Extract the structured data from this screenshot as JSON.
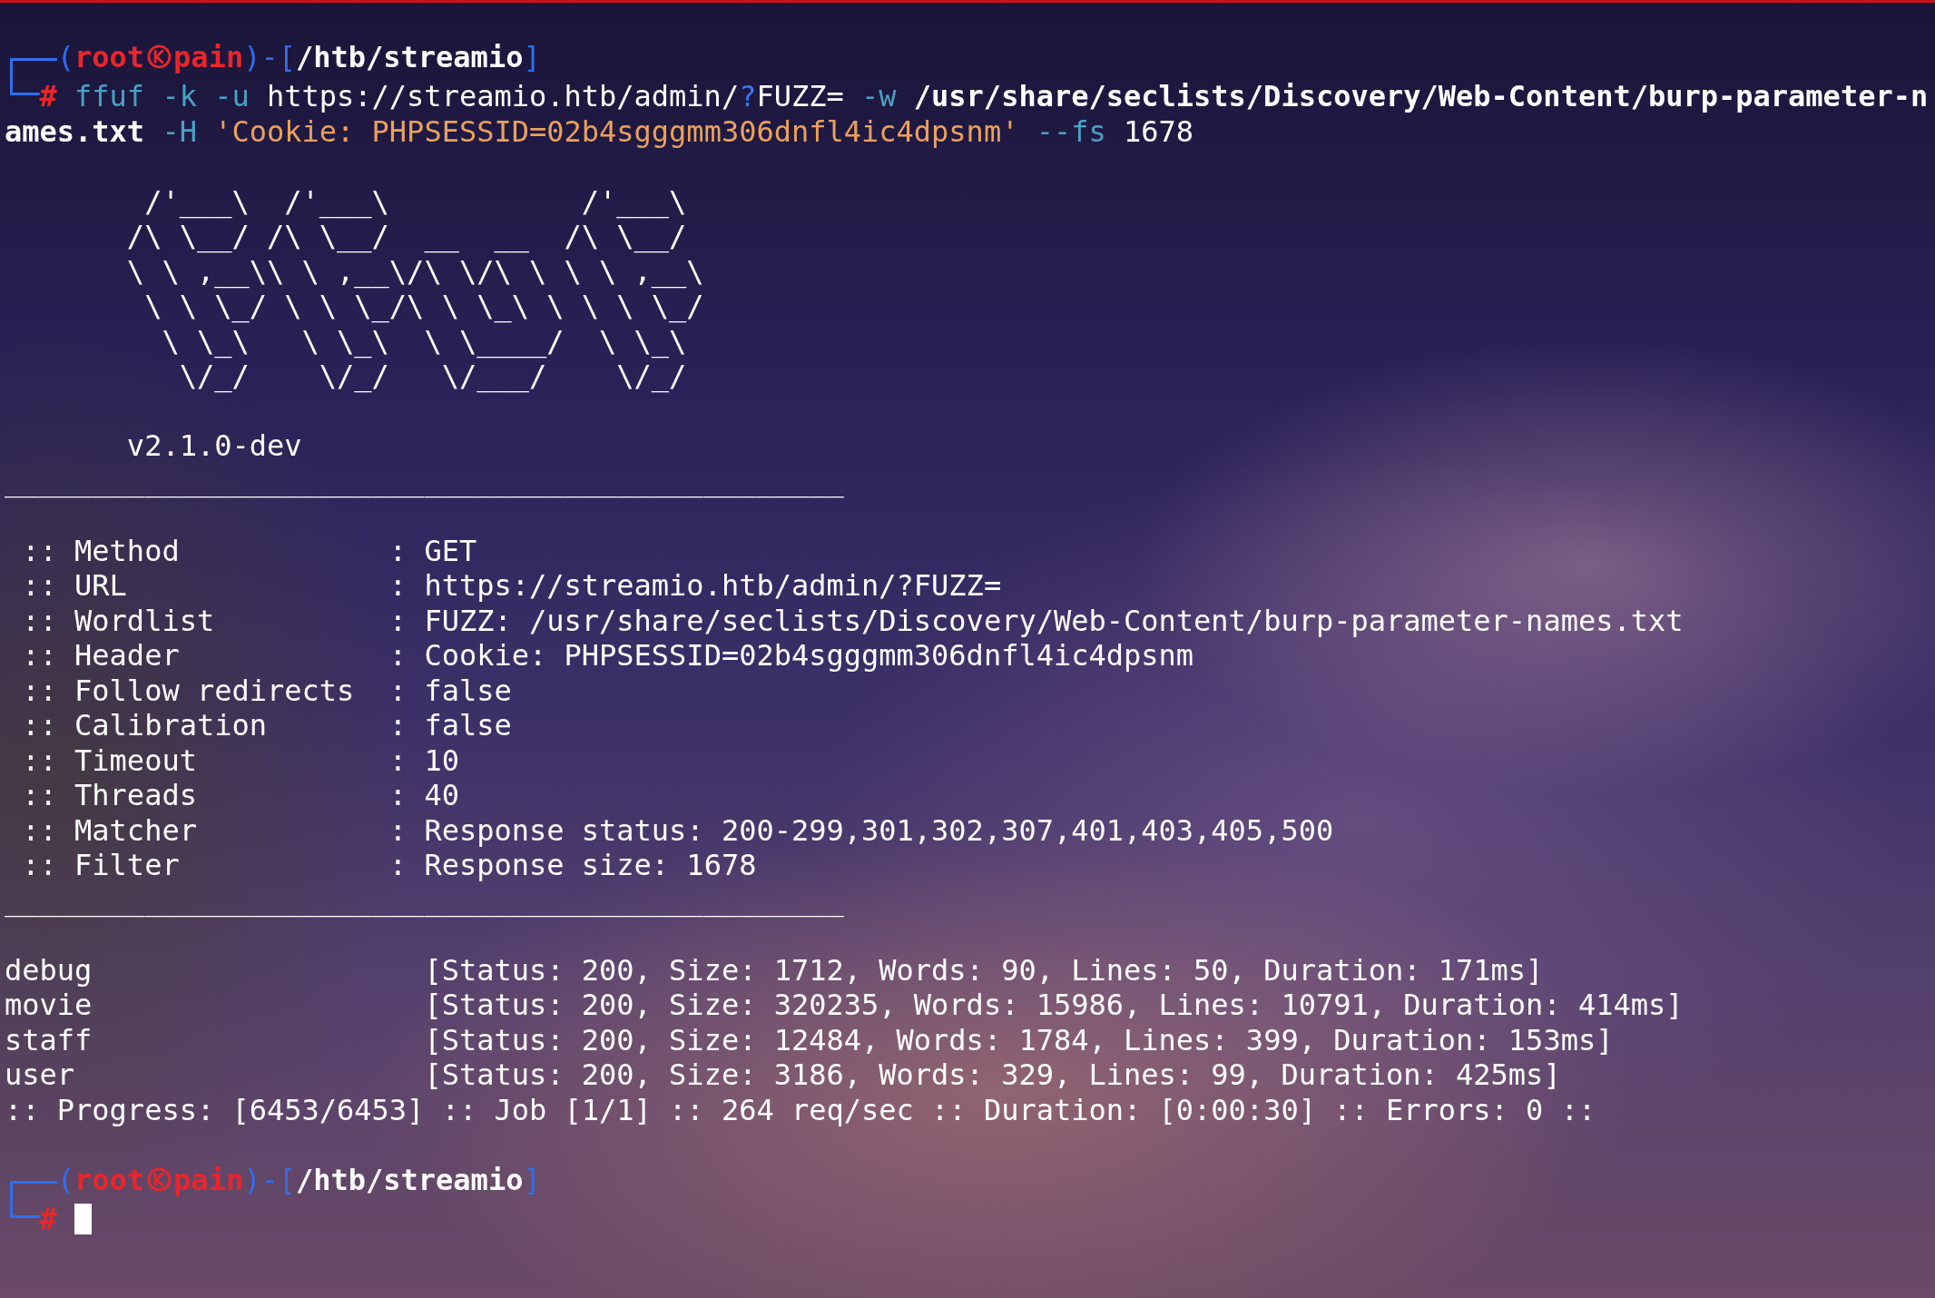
{
  "prompt": {
    "bracket_open": "(",
    "user": "root",
    "host": "pain",
    "separator": ")-[",
    "path": "/htb/streamio",
    "bracket_close": "]",
    "hash": "#",
    "command_rows": [
      [
        {
          "kind": "program",
          "text": "ffuf"
        },
        {
          "kind": "option",
          "text": "-k -u"
        },
        {
          "kind": "argument",
          "text": "https://streamio.htb/admin/"
        },
        {
          "kind": "special",
          "text": "?",
          "joined": true
        },
        {
          "kind": "argument",
          "text": "FUZZ=",
          "joined": true
        },
        {
          "kind": "option",
          "text": "-w"
        },
        {
          "kind": "path",
          "text": "/usr/share/seclists/Discovery/Web-Content/burp-parameter-n"
        }
      ],
      [
        {
          "kind": "path",
          "text": "ames.txt"
        },
        {
          "kind": "option",
          "text": "-H"
        },
        {
          "kind": "string",
          "text": "'Cookie: PHPSESSID=02b4sgggmm306dnfl4ic4dpsnm'"
        },
        {
          "kind": "option",
          "text": "--fs"
        },
        {
          "kind": "argument",
          "text": "1678"
        }
      ]
    ]
  },
  "banner": {
    "lines": [
      " /'___\\  /'___\\           /'___\\",
      "/\\ \\__/ /\\ \\__/  __  __  /\\ \\__/",
      "\\ \\ ,__\\\\ \\ ,__\\/\\ \\/\\ \\ \\ \\ ,__\\",
      " \\ \\ \\_/ \\ \\ \\_/\\ \\ \\_\\ \\ \\ \\ \\_/",
      "  \\ \\_\\   \\ \\_\\  \\ \\____/  \\ \\_\\",
      "   \\/_/    \\/_/   \\/___/    \\/_/"
    ],
    "version": "v2.1.0-dev"
  },
  "separator_top": "________________________________________________",
  "settings": [
    {
      "label": ":: Method",
      "value": ": GET"
    },
    {
      "label": ":: URL",
      "value": ": https://streamio.htb/admin/?FUZZ="
    },
    {
      "label": ":: Wordlist",
      "value": ": FUZZ: /usr/share/seclists/Discovery/Web-Content/burp-parameter-names.txt"
    },
    {
      "label": ":: Header",
      "value": ": Cookie: PHPSESSID=02b4sgggmm306dnfl4ic4dpsnm"
    },
    {
      "label": ":: Follow redirects",
      "value": ": false"
    },
    {
      "label": ":: Calibration",
      "value": ": false"
    },
    {
      "label": ":: Timeout",
      "value": ": 10"
    },
    {
      "label": ":: Threads",
      "value": ": 40"
    },
    {
      "label": ":: Matcher",
      "value": ": Response status: 200-299,301,302,307,401,403,405,500"
    },
    {
      "label": ":: Filter",
      "value": ": Response size: 1678"
    }
  ],
  "separator_bottom": "________________________________________________",
  "results": [
    {
      "name": "debug",
      "summary": "[Status: 200, Size: 1712, Words: 90, Lines: 50, Duration: 171ms]"
    },
    {
      "name": "movie",
      "summary": "[Status: 200, Size: 320235, Words: 15986, Lines: 10791, Duration: 414ms]"
    },
    {
      "name": "staff",
      "summary": "[Status: 200, Size: 12484, Words: 1784, Lines: 399, Duration: 153ms]"
    },
    {
      "name": "user",
      "summary": "[Status: 200, Size: 3186, Words: 329, Lines: 99, Duration: 425ms]"
    }
  ],
  "progress": ":: Progress: [6453/6453] :: Job [1/1] :: 264 req/sec :: Duration: [0:00:30] :: Errors: 0 ::",
  "next_prompt": {
    "bracket_open": "(",
    "user": "root",
    "host": "pain",
    "separator": ")-[",
    "path": "/htb/streamio",
    "bracket_close": "]",
    "hash": "#",
    "cursor": true
  }
}
